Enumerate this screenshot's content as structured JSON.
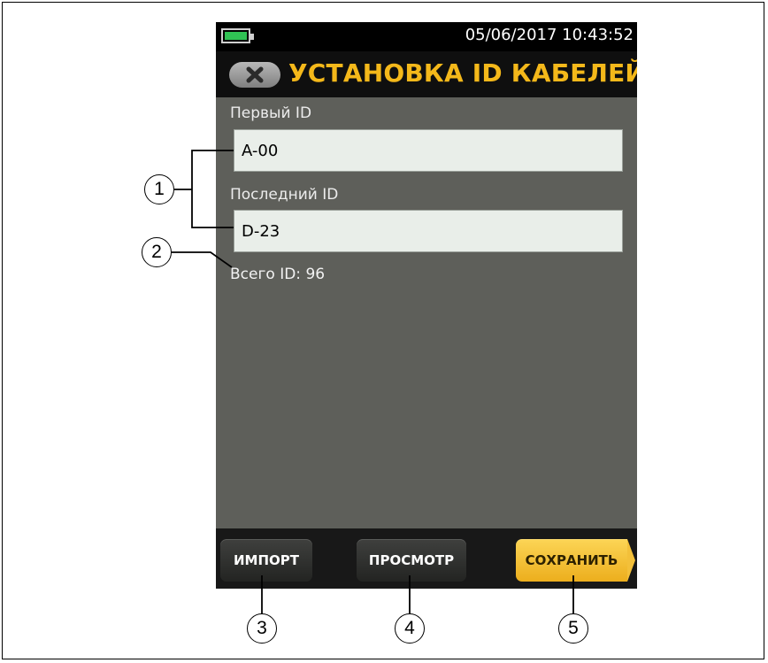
{
  "status_bar": {
    "datetime": "05/06/2017 10:43:52"
  },
  "title_bar": {
    "title": "УСТАНОВКА ID КАБЕЛЕЙ"
  },
  "form": {
    "first_id_label": "Первый ID",
    "first_id_value": "A-00",
    "last_id_label": "Последний ID",
    "last_id_value": "D-23",
    "total_text": "Всего ID: 96"
  },
  "buttons": {
    "import": "ИМПОРТ",
    "view": "ПРОСМОТР",
    "save": "СОХРАНИТЬ"
  },
  "callouts": [
    "1",
    "2",
    "3",
    "4",
    "5"
  ],
  "colors": {
    "title_accent": "#f4b81a",
    "save_button": "#f3c03a",
    "battery": "#30c254",
    "screen_background": "#5e5f5a"
  },
  "icons": [
    "battery-icon",
    "close-icon"
  ]
}
